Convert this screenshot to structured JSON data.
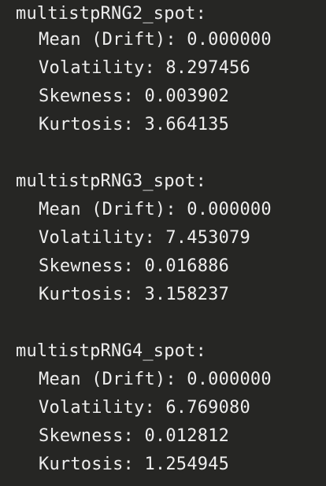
{
  "output_blocks": [
    {
      "name": "multistpRNG2_spot:",
      "stats": [
        {
          "label": "Mean (Drift):",
          "value": "0.000000"
        },
        {
          "label": "Volatility:",
          "value": "8.297456"
        },
        {
          "label": "Skewness:",
          "value": "0.003902"
        },
        {
          "label": "Kurtosis:",
          "value": "3.664135"
        }
      ]
    },
    {
      "name": "multistpRNG3_spot:",
      "stats": [
        {
          "label": "Mean (Drift):",
          "value": "0.000000"
        },
        {
          "label": "Volatility:",
          "value": "7.453079"
        },
        {
          "label": "Skewness:",
          "value": "0.016886"
        },
        {
          "label": "Kurtosis:",
          "value": "3.158237"
        }
      ]
    },
    {
      "name": "multistpRNG4_spot:",
      "stats": [
        {
          "label": "Mean (Drift):",
          "value": "0.000000"
        },
        {
          "label": "Volatility:",
          "value": "6.769080"
        },
        {
          "label": "Skewness:",
          "value": "0.012812"
        },
        {
          "label": "Kurtosis:",
          "value": "1.254945"
        }
      ]
    }
  ]
}
